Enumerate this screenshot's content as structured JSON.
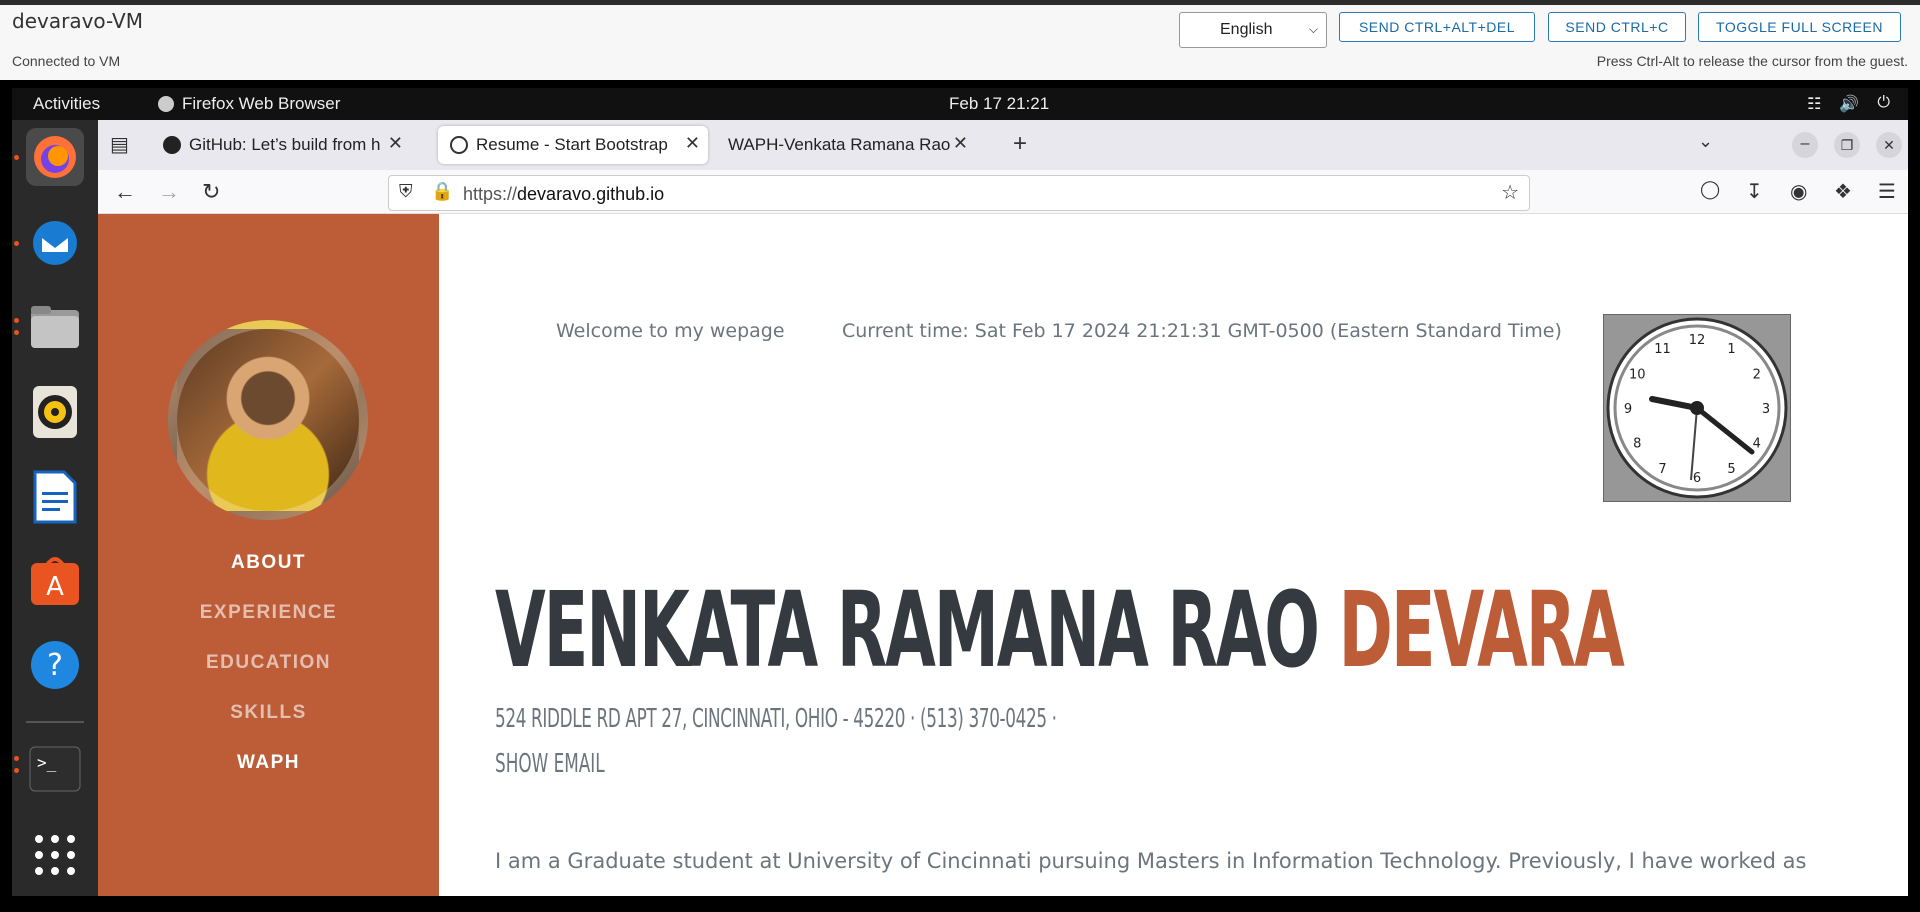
{
  "vm": {
    "title": "devaravo-VM",
    "status": "Connected to VM",
    "language": "English",
    "btn_ctrl_alt_del": "SEND CTRL+ALT+DEL",
    "btn_ctrl_c": "SEND CTRL+C",
    "btn_fullscreen": "TOGGLE FULL SCREEN",
    "hint": "Press Ctrl-Alt to release the cursor from the guest."
  },
  "gnome": {
    "activities": "Activities",
    "app_name": "Firefox Web Browser",
    "clock": "Feb 17  21:21"
  },
  "dock": {
    "items": [
      {
        "name": "firefox-icon"
      },
      {
        "name": "thunderbird-icon"
      },
      {
        "name": "files-icon"
      },
      {
        "name": "rhythmbox-icon"
      },
      {
        "name": "writer-icon"
      },
      {
        "name": "app-center-icon"
      },
      {
        "name": "help-icon"
      },
      {
        "name": "terminal-icon"
      },
      {
        "name": "show-apps-icon"
      }
    ]
  },
  "browser": {
    "tabs": [
      {
        "title": "GitHub: Let’s build from h"
      },
      {
        "title": "Resume - Start Bootstrap"
      },
      {
        "title": "WAPH-Venkata Ramana Rao"
      }
    ],
    "url_prefix": "https://",
    "url_domain": "devaravo.github.io"
  },
  "page": {
    "nav": [
      "ABOUT",
      "EXPERIENCE",
      "EDUCATION",
      "SKILLS",
      "WAPH"
    ],
    "welcome": "Welcome to my wepage",
    "current_time": "Current time: Sat Feb 17 2024 21:21:31 GMT-0500 (Eastern Standard Time)",
    "name_first": "VENKATA RAMANA RAO",
    "name_last": "DEVARA",
    "address": "524 RIDDLE RD APT 27, CINCINNATI, OHIO - 45220 · (513) 370-0425 ·",
    "show_email": "SHOW EMAIL",
    "bio": "I am a Graduate student at University of Cincinnati pursuing Masters in Information Technology. Previously, I have worked as",
    "clock_numbers": [
      "12",
      "1",
      "2",
      "3",
      "4",
      "5",
      "6",
      "7",
      "8",
      "9",
      "10",
      "11"
    ]
  }
}
